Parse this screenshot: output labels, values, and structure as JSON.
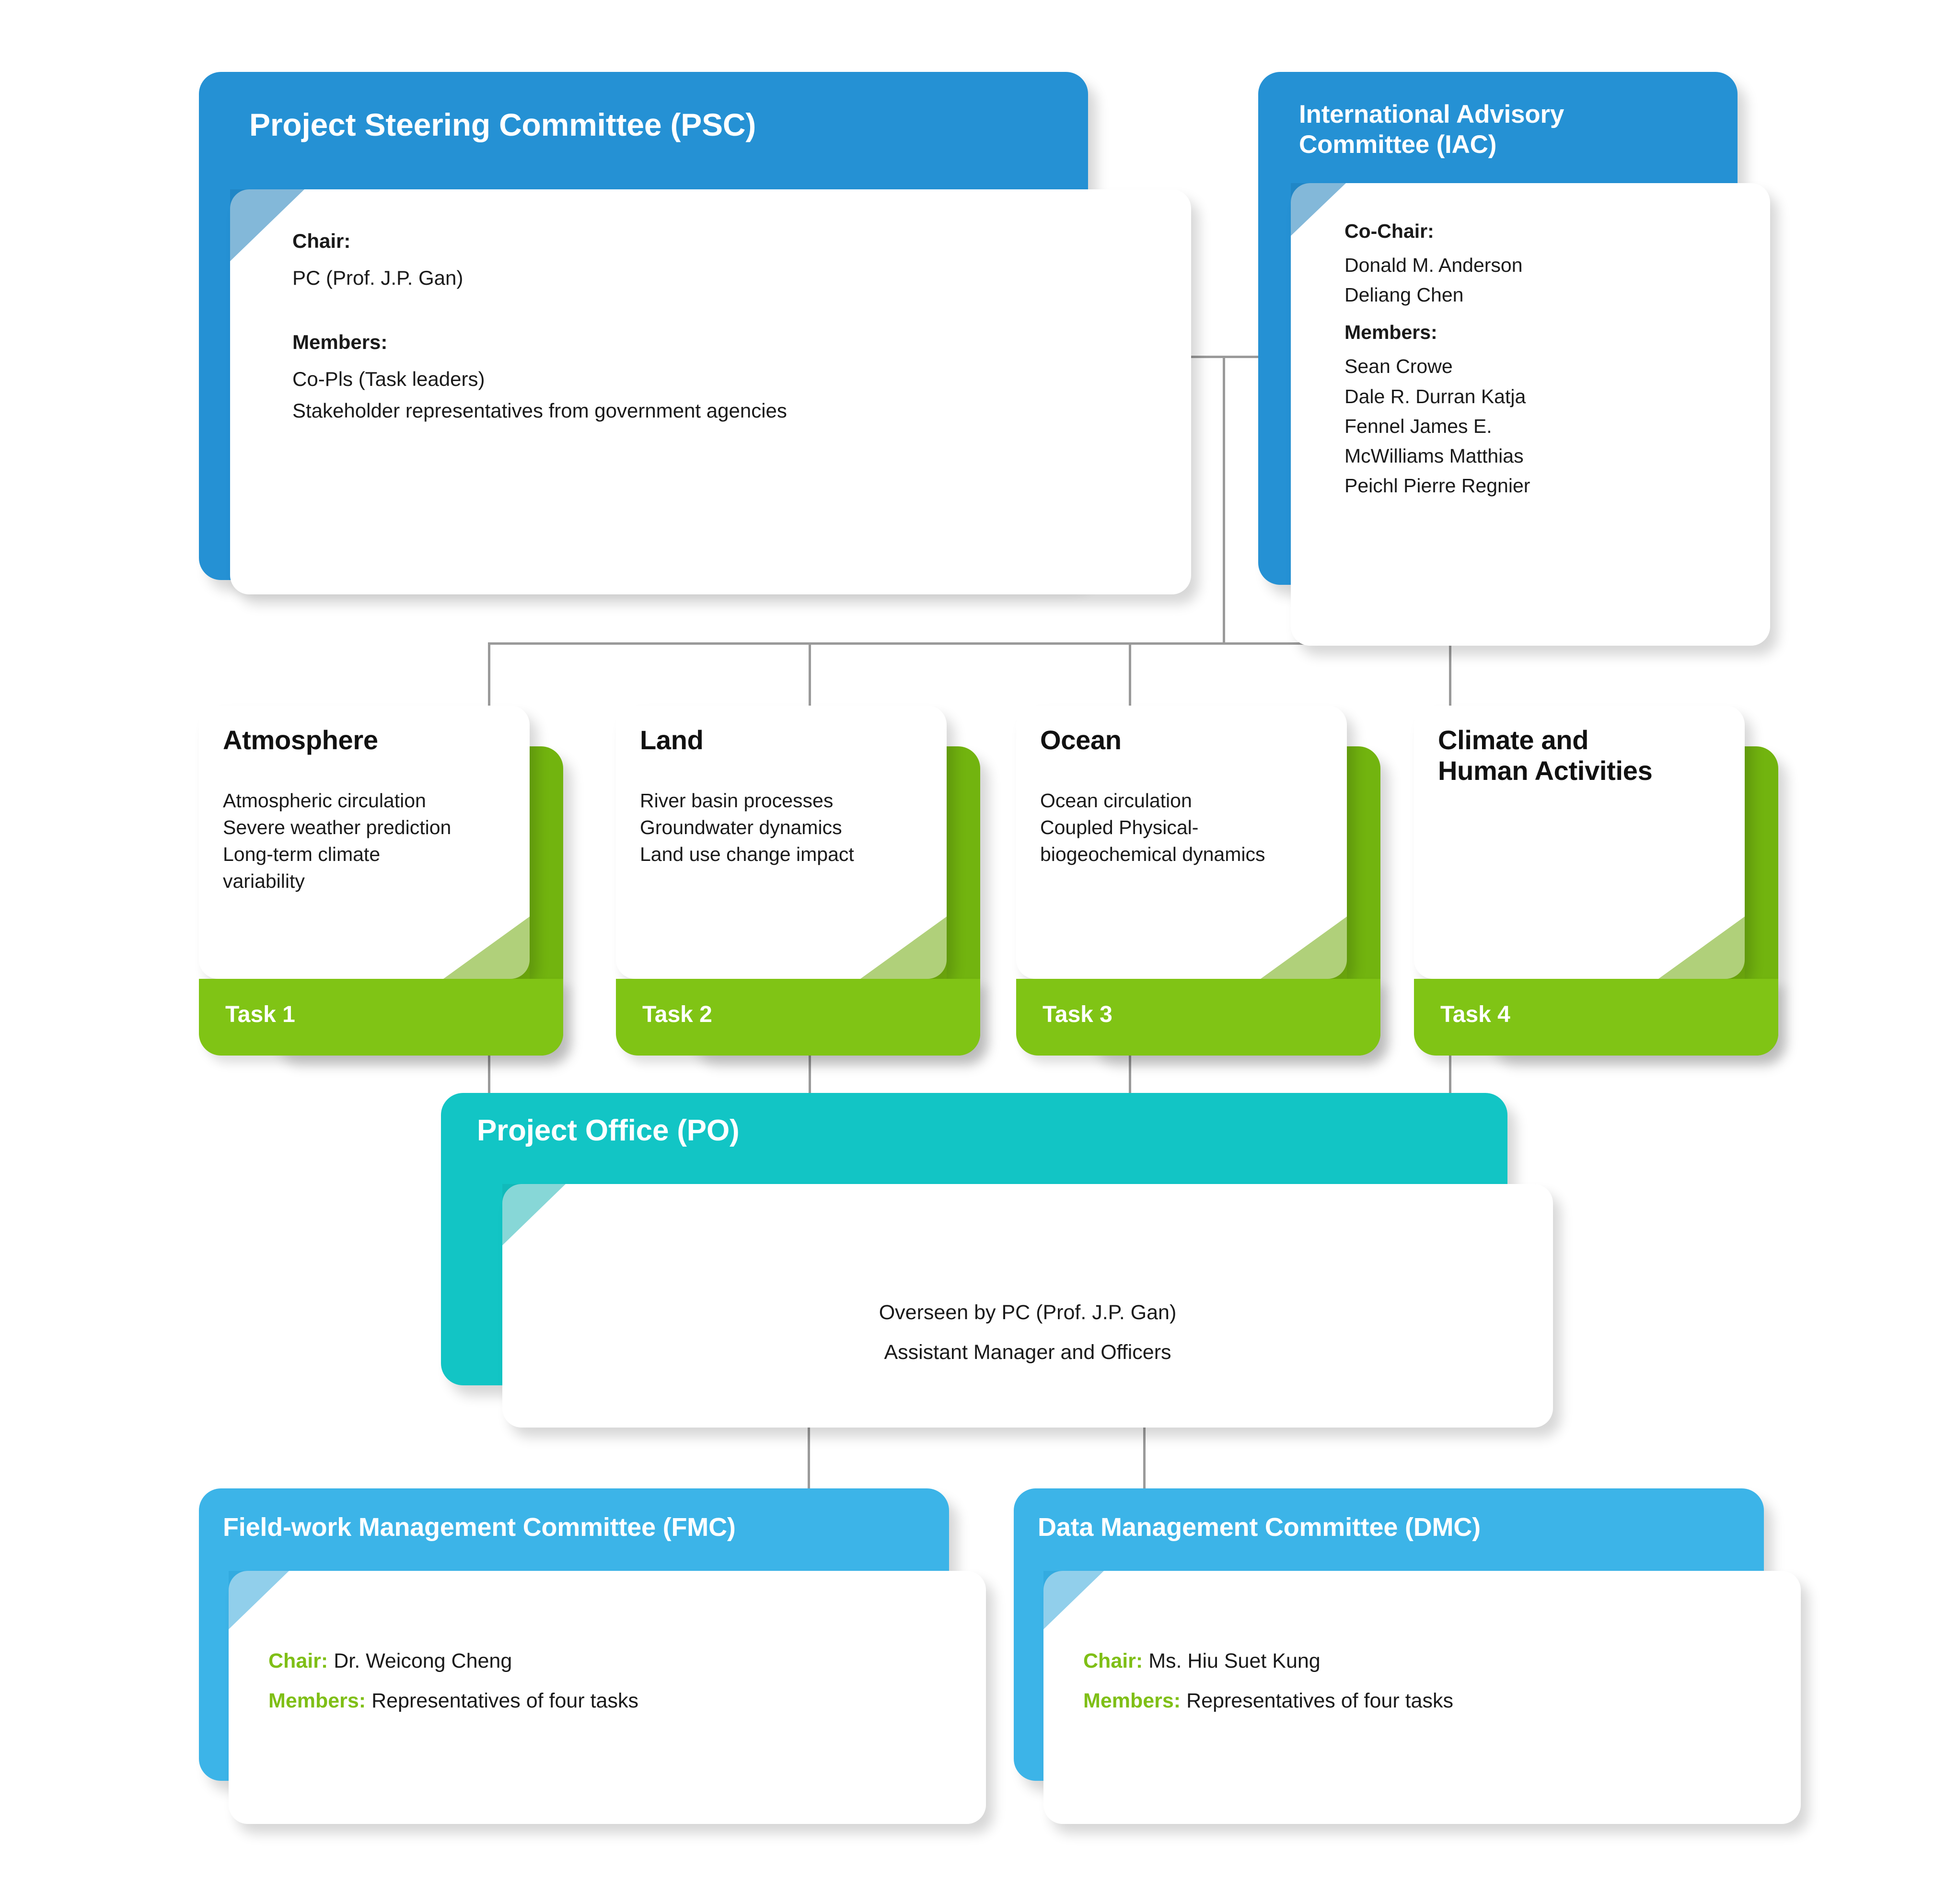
{
  "colors": {
    "blue": "#2591D4",
    "blue_light": "#3CB4E8",
    "green": "#80C415",
    "green_dark": "#72B40F",
    "teal": "#12C5C5",
    "teal_dark": "#0FB5B5",
    "label_green": "#7FBF16",
    "line_gray": "#9a9a9a",
    "text": "#1a1a1a",
    "white": "#ffffff"
  },
  "psc": {
    "title": "Project Steering Committee (PSC)",
    "chair_label": "Chair:",
    "chair_value": "PC (Prof. J.P. Gan)",
    "members_label": "Members:",
    "members": [
      "Co-Pls (Task leaders)",
      "Stakeholder representatives from government agencies"
    ]
  },
  "iac": {
    "title_line1": "International Advisory",
    "title_line2": "Committee (IAC)",
    "cochair_label": "Co-Chair:",
    "cochairs": [
      "Donald M. Anderson",
      "Deliang Chen"
    ],
    "members_label": "Members:",
    "members": [
      "Sean Crowe",
      "Dale R. Durran Katja",
      "Fennel James E.",
      "McWilliams Matthias",
      "Peichl Pierre Regnier"
    ]
  },
  "tasks": [
    {
      "title_line1": "Atmosphere",
      "title_line2": "",
      "items": [
        "Atmospheric circulation",
        "Severe weather prediction",
        "Long-term climate",
        "variability"
      ],
      "footer": "Task 1"
    },
    {
      "title_line1": "Land",
      "title_line2": "",
      "items": [
        "River basin processes",
        "Groundwater dynamics",
        "Land use change impact"
      ],
      "footer": "Task 2"
    },
    {
      "title_line1": "Ocean",
      "title_line2": "",
      "items": [
        "Ocean circulation",
        "Coupled Physical-",
        "biogeochemical dynamics"
      ],
      "footer": "Task 3"
    },
    {
      "title_line1": "Climate and",
      "title_line2": "Human Activities",
      "items": [],
      "footer": "Task 4"
    }
  ],
  "project_office": {
    "title": "Project Office (PO)",
    "lines": [
      "Overseen by PC (Prof. J.P. Gan)",
      "Assistant Manager and Officers"
    ]
  },
  "fmc": {
    "title": "Field-work Management Committee (FMC)",
    "chair_label": "Chair:",
    "chair_value": "Dr. Weicong Cheng",
    "members_label": "Members:",
    "members_value": "Representatives of four tasks"
  },
  "dmc": {
    "title": "Data Management Committee (DMC)",
    "chair_label": "Chair:",
    "chair_value": "Ms. Hiu Suet Kung",
    "members_label": "Members:",
    "members_value": "Representatives of four tasks"
  }
}
